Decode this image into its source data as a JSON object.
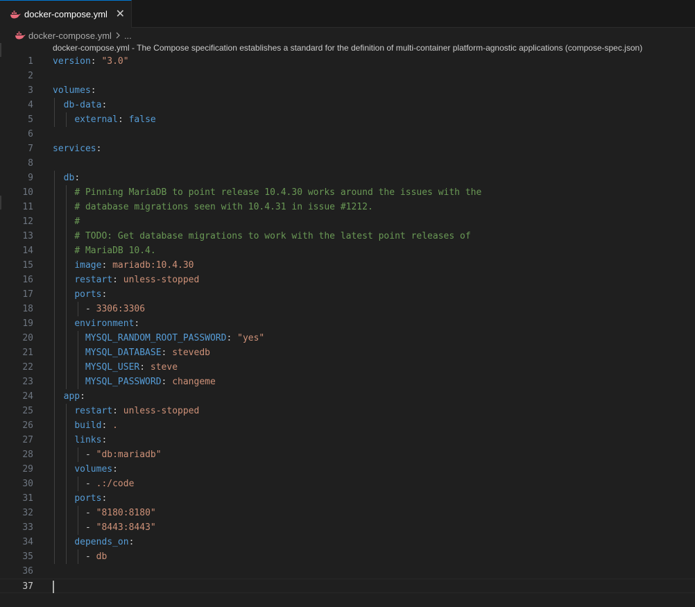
{
  "tab": {
    "label": "docker-compose.yml",
    "close": "✕"
  },
  "breadcrumb": {
    "file": "docker-compose.yml",
    "more": "..."
  },
  "schema_hint": "docker-compose.yml - The Compose specification establishes a standard for the definition of multi-container platform-agnostic applications (compose-spec.json)",
  "editor": {
    "current_line": 37,
    "lines": [
      {
        "n": "1",
        "tokens": [
          {
            "t": "version",
            "c": "k"
          },
          {
            "t": ": ",
            "c": "p"
          },
          {
            "t": "\"3.0\"",
            "c": "s"
          }
        ]
      },
      {
        "n": "2",
        "tokens": []
      },
      {
        "n": "3",
        "tokens": [
          {
            "t": "volumes",
            "c": "k"
          },
          {
            "t": ":",
            "c": "p"
          }
        ]
      },
      {
        "n": "4",
        "tokens": [
          {
            "t": "  ",
            "c": "p"
          },
          {
            "t": "db-data",
            "c": "k"
          },
          {
            "t": ":",
            "c": "p"
          }
        ]
      },
      {
        "n": "5",
        "tokens": [
          {
            "t": "    ",
            "c": "p"
          },
          {
            "t": "external",
            "c": "k"
          },
          {
            "t": ": ",
            "c": "p"
          },
          {
            "t": "false",
            "c": "k"
          }
        ]
      },
      {
        "n": "6",
        "tokens": []
      },
      {
        "n": "7",
        "tokens": [
          {
            "t": "services",
            "c": "k"
          },
          {
            "t": ":",
            "c": "p"
          }
        ]
      },
      {
        "n": "8",
        "tokens": []
      },
      {
        "n": "9",
        "tokens": [
          {
            "t": "  ",
            "c": "p"
          },
          {
            "t": "db",
            "c": "k"
          },
          {
            "t": ":",
            "c": "p"
          }
        ]
      },
      {
        "n": "10",
        "tokens": [
          {
            "t": "    ",
            "c": "p"
          },
          {
            "t": "# Pinning MariaDB to point release 10.4.30 works around the issues with the",
            "c": "c"
          }
        ]
      },
      {
        "n": "11",
        "tokens": [
          {
            "t": "    ",
            "c": "p"
          },
          {
            "t": "# database migrations seen with 10.4.31 in issue #1212.",
            "c": "c"
          }
        ]
      },
      {
        "n": "12",
        "tokens": [
          {
            "t": "    ",
            "c": "p"
          },
          {
            "t": "#",
            "c": "c"
          }
        ]
      },
      {
        "n": "13",
        "tokens": [
          {
            "t": "    ",
            "c": "p"
          },
          {
            "t": "# TODO: Get database migrations to work with the latest point releases of",
            "c": "c"
          }
        ]
      },
      {
        "n": "14",
        "tokens": [
          {
            "t": "    ",
            "c": "p"
          },
          {
            "t": "# MariaDB 10.4.",
            "c": "c"
          }
        ]
      },
      {
        "n": "15",
        "tokens": [
          {
            "t": "    ",
            "c": "p"
          },
          {
            "t": "image",
            "c": "k"
          },
          {
            "t": ": ",
            "c": "p"
          },
          {
            "t": "mariadb:10.4.30",
            "c": "s"
          }
        ]
      },
      {
        "n": "16",
        "tokens": [
          {
            "t": "    ",
            "c": "p"
          },
          {
            "t": "restart",
            "c": "k"
          },
          {
            "t": ": ",
            "c": "p"
          },
          {
            "t": "unless-stopped",
            "c": "s"
          }
        ]
      },
      {
        "n": "17",
        "tokens": [
          {
            "t": "    ",
            "c": "p"
          },
          {
            "t": "ports",
            "c": "k"
          },
          {
            "t": ":",
            "c": "p"
          }
        ]
      },
      {
        "n": "18",
        "tokens": [
          {
            "t": "      - ",
            "c": "p"
          },
          {
            "t": "3306:3306",
            "c": "s"
          }
        ]
      },
      {
        "n": "19",
        "tokens": [
          {
            "t": "    ",
            "c": "p"
          },
          {
            "t": "environment",
            "c": "k"
          },
          {
            "t": ":",
            "c": "p"
          }
        ]
      },
      {
        "n": "20",
        "tokens": [
          {
            "t": "      ",
            "c": "p"
          },
          {
            "t": "MYSQL_RANDOM_ROOT_PASSWORD",
            "c": "k"
          },
          {
            "t": ": ",
            "c": "p"
          },
          {
            "t": "\"yes\"",
            "c": "s"
          }
        ]
      },
      {
        "n": "21",
        "tokens": [
          {
            "t": "      ",
            "c": "p"
          },
          {
            "t": "MYSQL_DATABASE",
            "c": "k"
          },
          {
            "t": ": ",
            "c": "p"
          },
          {
            "t": "stevedb",
            "c": "s"
          }
        ]
      },
      {
        "n": "22",
        "tokens": [
          {
            "t": "      ",
            "c": "p"
          },
          {
            "t": "MYSQL_USER",
            "c": "k"
          },
          {
            "t": ": ",
            "c": "p"
          },
          {
            "t": "steve",
            "c": "s"
          }
        ]
      },
      {
        "n": "23",
        "tokens": [
          {
            "t": "      ",
            "c": "p"
          },
          {
            "t": "MYSQL_PASSWORD",
            "c": "k"
          },
          {
            "t": ": ",
            "c": "p"
          },
          {
            "t": "changeme",
            "c": "s"
          }
        ]
      },
      {
        "n": "24",
        "tokens": [
          {
            "t": "  ",
            "c": "p"
          },
          {
            "t": "app",
            "c": "k"
          },
          {
            "t": ":",
            "c": "p"
          }
        ]
      },
      {
        "n": "25",
        "tokens": [
          {
            "t": "    ",
            "c": "p"
          },
          {
            "t": "restart",
            "c": "k"
          },
          {
            "t": ": ",
            "c": "p"
          },
          {
            "t": "unless-stopped",
            "c": "s"
          }
        ]
      },
      {
        "n": "26",
        "tokens": [
          {
            "t": "    ",
            "c": "p"
          },
          {
            "t": "build",
            "c": "k"
          },
          {
            "t": ": ",
            "c": "p"
          },
          {
            "t": ".",
            "c": "s"
          }
        ]
      },
      {
        "n": "27",
        "tokens": [
          {
            "t": "    ",
            "c": "p"
          },
          {
            "t": "links",
            "c": "k"
          },
          {
            "t": ":",
            "c": "p"
          }
        ]
      },
      {
        "n": "28",
        "tokens": [
          {
            "t": "      - ",
            "c": "p"
          },
          {
            "t": "\"db:mariadb\"",
            "c": "s"
          }
        ]
      },
      {
        "n": "29",
        "tokens": [
          {
            "t": "    ",
            "c": "p"
          },
          {
            "t": "volumes",
            "c": "k"
          },
          {
            "t": ":",
            "c": "p"
          }
        ]
      },
      {
        "n": "30",
        "tokens": [
          {
            "t": "      - ",
            "c": "p"
          },
          {
            "t": ".:/code",
            "c": "s"
          }
        ]
      },
      {
        "n": "31",
        "tokens": [
          {
            "t": "    ",
            "c": "p"
          },
          {
            "t": "ports",
            "c": "k"
          },
          {
            "t": ":",
            "c": "p"
          }
        ]
      },
      {
        "n": "32",
        "tokens": [
          {
            "t": "      - ",
            "c": "p"
          },
          {
            "t": "\"8180:8180\"",
            "c": "s"
          }
        ]
      },
      {
        "n": "33",
        "tokens": [
          {
            "t": "      - ",
            "c": "p"
          },
          {
            "t": "\"8443:8443\"",
            "c": "s"
          }
        ]
      },
      {
        "n": "34",
        "tokens": [
          {
            "t": "    ",
            "c": "p"
          },
          {
            "t": "depends_on",
            "c": "k"
          },
          {
            "t": ":",
            "c": "p"
          }
        ]
      },
      {
        "n": "35",
        "tokens": [
          {
            "t": "      - ",
            "c": "p"
          },
          {
            "t": "db",
            "c": "s"
          }
        ]
      },
      {
        "n": "36",
        "tokens": []
      },
      {
        "n": "37",
        "tokens": []
      }
    ]
  },
  "colors": {
    "key": "#569cd6",
    "string": "#ce9178",
    "comment": "#6a9955",
    "accent": "#0078d4",
    "background": "#1f1f1f"
  },
  "icons": {
    "file": "docker-whale-icon",
    "close": "close-icon",
    "chevron": "chevron-right-icon"
  }
}
